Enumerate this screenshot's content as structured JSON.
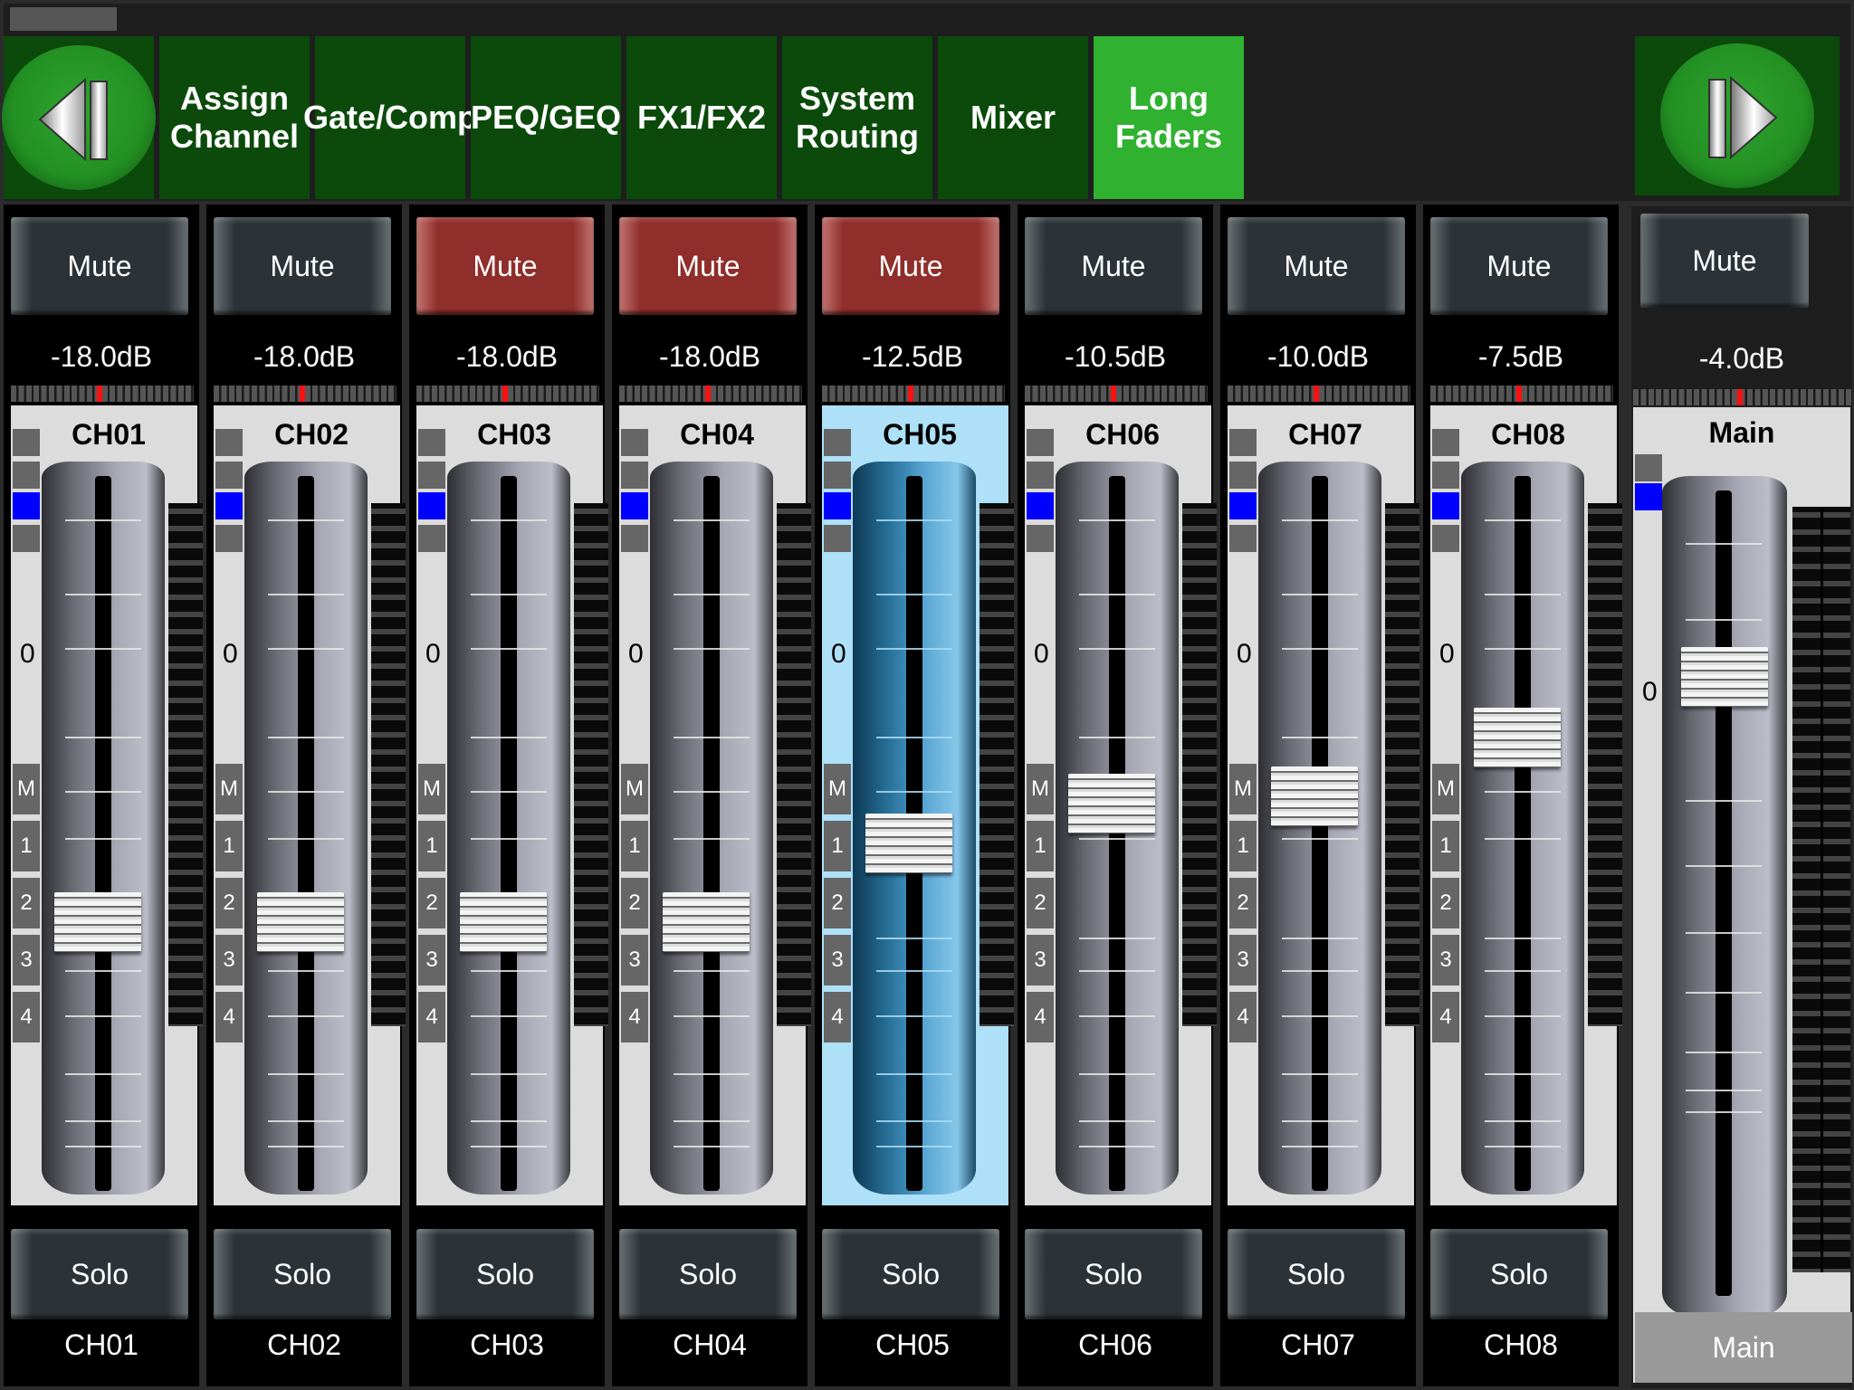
{
  "nav": {
    "prev_icon": "skip-back-icon",
    "next_icon": "skip-forward-icon",
    "tabs": [
      {
        "label": "Assign\nChannel",
        "active": false
      },
      {
        "label": "Gate/Comp",
        "active": false
      },
      {
        "label": "PEQ/GEQ",
        "active": false
      },
      {
        "label": "FX1/FX2",
        "active": false
      },
      {
        "label": "System\nRouting",
        "active": false
      },
      {
        "label": "Mixer",
        "active": false
      },
      {
        "label": "Long\nFaders",
        "active": true
      }
    ]
  },
  "colors": {
    "nav_bg": "#0b4a0b",
    "nav_active": "#30b230",
    "mute_on": "#8f2e2a",
    "selected_strip": "#aee0f8",
    "bus_selected": "#0000ff",
    "pan_marker": "#ff1010"
  },
  "labels": {
    "mute": "Mute",
    "solo": "Solo",
    "zero_mark": "0",
    "bus": [
      "M",
      "1",
      "2",
      "3",
      "4"
    ]
  },
  "channels": [
    {
      "name": "CH01",
      "level": "-18.0dB",
      "muted": false,
      "selected": false,
      "fader_pos": 0.67,
      "pan": 0.5
    },
    {
      "name": "CH02",
      "level": "-18.0dB",
      "muted": false,
      "selected": false,
      "fader_pos": 0.67,
      "pan": 0.5
    },
    {
      "name": "CH03",
      "level": "-18.0dB",
      "muted": true,
      "selected": false,
      "fader_pos": 0.67,
      "pan": 0.5
    },
    {
      "name": "CH04",
      "level": "-18.0dB",
      "muted": true,
      "selected": false,
      "fader_pos": 0.67,
      "pan": 0.5
    },
    {
      "name": "CH05",
      "level": "-12.5dB",
      "muted": true,
      "selected": true,
      "fader_pos": 0.55,
      "pan": 0.5
    },
    {
      "name": "CH06",
      "level": "-10.5dB",
      "muted": false,
      "selected": false,
      "fader_pos": 0.49,
      "pan": 0.5
    },
    {
      "name": "CH07",
      "level": "-10.0dB",
      "muted": false,
      "selected": false,
      "fader_pos": 0.48,
      "pan": 0.5
    },
    {
      "name": "CH08",
      "level": "-7.5dB",
      "muted": false,
      "selected": false,
      "fader_pos": 0.39,
      "pan": 0.5
    }
  ],
  "main": {
    "name": "Main",
    "footer": "Main",
    "level": "-4.0dB",
    "muted": false,
    "fader_pos": 0.24,
    "pan": 0.5
  }
}
